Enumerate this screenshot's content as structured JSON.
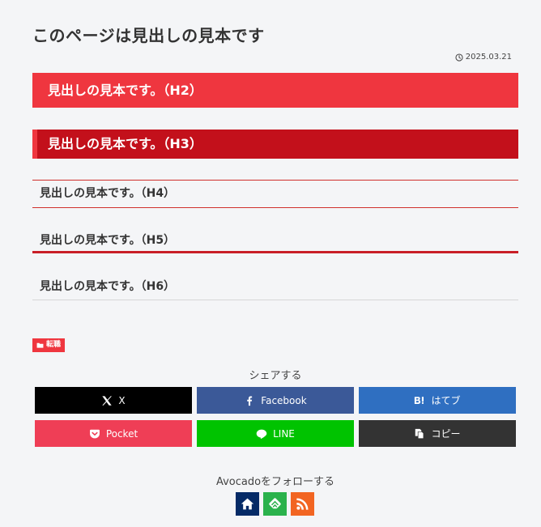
{
  "page": {
    "title": "このページは見出しの見本です",
    "date": "2025.03.21"
  },
  "headings": {
    "h2": "見出しの見本です。（H2）",
    "h3": "見出しの見本です。（H3）",
    "h4": "見出しの見本です。（H4）",
    "h5": "見出しの見本です。（H5）",
    "h6": "見出しの見本です。（H6）"
  },
  "category": {
    "label": "転職",
    "icon": "folder-icon"
  },
  "share": {
    "title": "シェアする",
    "buttons": [
      {
        "label": "X",
        "icon": "x-icon",
        "color": "#000000"
      },
      {
        "label": "Facebook",
        "icon": "facebook-icon",
        "color": "#3b5998"
      },
      {
        "label": "はてブ",
        "icon": "hatena-icon",
        "color": "#2f6fc1"
      },
      {
        "label": "Pocket",
        "icon": "pocket-icon",
        "color": "#ef3e56"
      },
      {
        "label": "LINE",
        "icon": "line-icon",
        "color": "#00c300"
      },
      {
        "label": "コピー",
        "icon": "copy-icon",
        "color": "#333333"
      }
    ]
  },
  "follow": {
    "title": "Avocadoをフォローする",
    "buttons": [
      {
        "icon": "home-icon",
        "color": "#052a66"
      },
      {
        "icon": "feedly-icon",
        "color": "#2bb24c"
      },
      {
        "icon": "rss-icon",
        "color": "#f26522"
      }
    ]
  },
  "colors": {
    "accent": "#ef363f",
    "accent_dark": "#c3101b"
  }
}
